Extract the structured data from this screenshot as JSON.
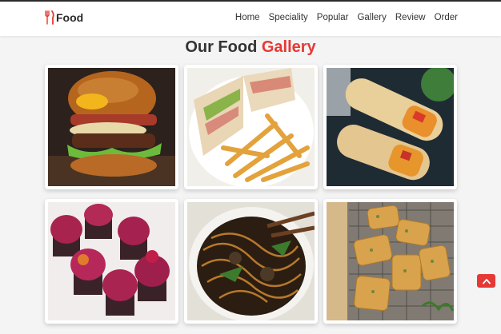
{
  "brand": {
    "name": "Food",
    "icon": "fork-knife-icon",
    "accent": "#e53935"
  },
  "nav": {
    "items": [
      {
        "label": "Home"
      },
      {
        "label": "Speciality"
      },
      {
        "label": "Popular"
      },
      {
        "label": "Gallery"
      },
      {
        "label": "Review"
      },
      {
        "label": "Order"
      }
    ]
  },
  "gallery": {
    "title_prefix": "Our Food",
    "title_accent": "Gallery",
    "images": [
      {
        "subject": "burger"
      },
      {
        "subject": "sandwich-and-fries"
      },
      {
        "subject": "wraps"
      },
      {
        "subject": "cupcakes"
      },
      {
        "subject": "noodles"
      },
      {
        "subject": "garlic-bread"
      }
    ]
  },
  "scroll_top": {
    "icon": "chevron-up-icon"
  }
}
